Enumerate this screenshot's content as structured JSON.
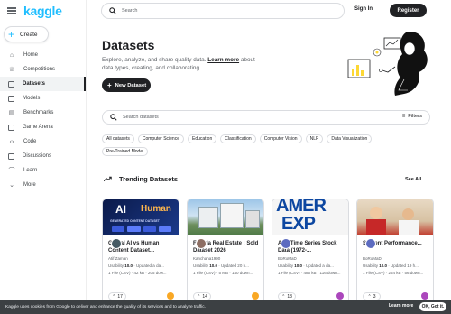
{
  "brand": {
    "logo": "kaggle"
  },
  "sidebar": {
    "create_label": "Create",
    "items": [
      {
        "label": "Home",
        "icon": "home-icon"
      },
      {
        "label": "Competitions",
        "icon": "trophy-icon"
      },
      {
        "label": "Datasets",
        "icon": "table-icon"
      },
      {
        "label": "Models",
        "icon": "models-icon"
      },
      {
        "label": "Benchmarks",
        "icon": "benchmarks-icon"
      },
      {
        "label": "Game Arena",
        "icon": "game-icon"
      },
      {
        "label": "Code",
        "icon": "code-icon"
      },
      {
        "label": "Discussions",
        "icon": "discussion-icon"
      },
      {
        "label": "Learn",
        "icon": "learn-icon"
      },
      {
        "label": "More",
        "icon": "chevron-down-icon"
      }
    ],
    "active_index": 2
  },
  "header": {
    "search_placeholder": "Search",
    "signin_label": "Sign In",
    "register_label": "Register"
  },
  "hero": {
    "title": "Datasets",
    "description_prefix": "Explore, analyze, and share quality data. ",
    "learn_more": "Learn more",
    "description_suffix": " about data types, creating, and collaborating.",
    "new_dataset_label": "New Dataset"
  },
  "search": {
    "placeholder": "Search datasets",
    "filters_label": "Filters"
  },
  "chips": [
    "All datasets",
    "Computer Science",
    "Education",
    "Classification",
    "Computer Vision",
    "NLP",
    "Data Visualization",
    "Pre-Trained Model"
  ],
  "trending": {
    "title": "Trending Datasets",
    "see_all": "See All",
    "cards": [
      {
        "title": "Global AI vs Human Content Dataset...",
        "author": "Atif Zaman",
        "usability_label": "Usability",
        "usability": "10.0",
        "updated": "Updated a da...",
        "files": "1 File (CSV)",
        "size": "42 kB",
        "downloads": "205 dow...",
        "votes": "17",
        "thumb_text_1": "AI",
        "thumb_text_2": "Human",
        "thumb_caption": "GENERATED CONTENT DATASET"
      },
      {
        "title": "Florida Real Estate : Sold Dataset 2026",
        "author": "Kanchana1990",
        "usability_label": "Usability",
        "usability": "10.0",
        "updated": "Updated 20 h...",
        "files": "1 File (CSV)",
        "size": "5 MB",
        "downloads": "140 down...",
        "votes": "14"
      },
      {
        "title": "AXP Time Series Stock Data (1972-...",
        "author": "BoRoMaD",
        "usability_label": "Usability",
        "usability": "10.0",
        "updated": "Updated a da...",
        "files": "1 File (CSV)",
        "size": "485 kB",
        "downloads": "116 down...",
        "votes": "13",
        "thumb_text_1": "AMER",
        "thumb_text_2": "EXP"
      },
      {
        "title": "Student Performance...",
        "author": "BoRoMaD",
        "usability_label": "Usability",
        "usability": "10.0",
        "updated": "Updated 19 h...",
        "files": "1 File (CSV)",
        "size": "264 kB",
        "downloads": "56 down...",
        "votes": "3"
      }
    ]
  },
  "cookie": {
    "text": "Kaggle uses cookies from Google to deliver and enhance the quality of its services and to analyze traffic.",
    "learn_more": "Learn more",
    "ok": "OK, Got it."
  },
  "colors": {
    "brand": "#20beff",
    "dark": "#202124",
    "border": "#dadce0"
  }
}
